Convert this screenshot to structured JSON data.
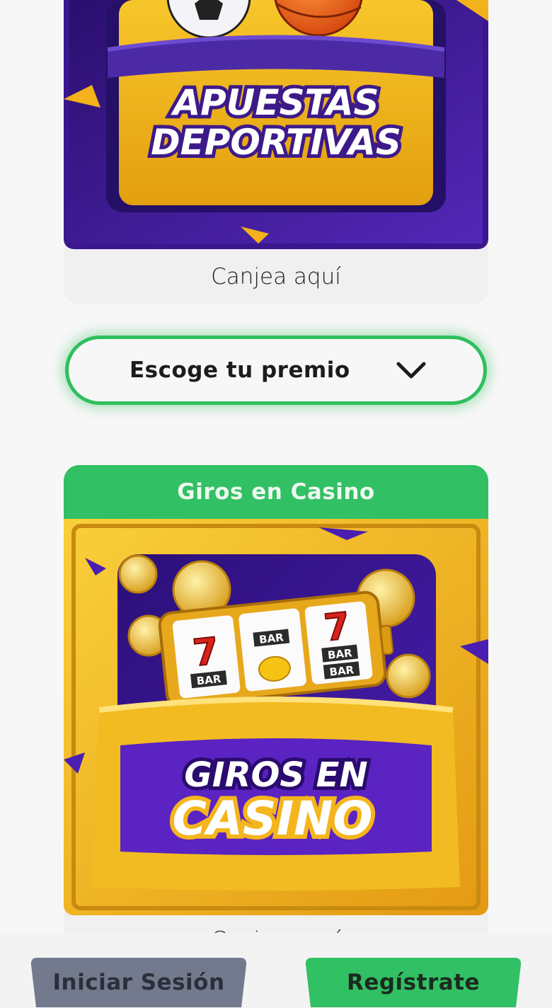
{
  "sports_card": {
    "banner_text_line1": "APUESTAS",
    "banner_text_line2": "DEPORTIVAS",
    "caption": "Canjea aquí"
  },
  "prize_select": {
    "label": "Escoge tu premio",
    "icon": "chevron-down-icon"
  },
  "casino_card": {
    "header": "Giros en Casino",
    "banner_text_line1": "GIROS EN",
    "banner_text_line2": "CASINO",
    "reel_labels": [
      "7",
      "BAR",
      "BAR",
      "7",
      "BAR",
      "BAR"
    ],
    "caption": "Canjea aquí"
  },
  "bottom_bar": {
    "login_label": "Iniciar Sesión",
    "register_label": "Regístrate"
  },
  "colors": {
    "accent_green": "#31c063",
    "login_gray": "#737a8e",
    "purple": "#3d1a8a",
    "gold": "#f2b418"
  }
}
